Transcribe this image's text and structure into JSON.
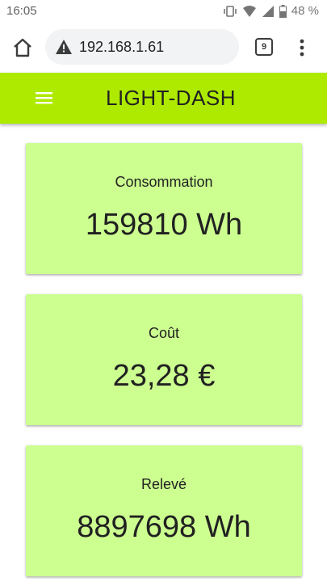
{
  "status_bar": {
    "time": "16:05",
    "battery": "48 %"
  },
  "browser": {
    "url": "192.168.1.61",
    "tab_count": "9"
  },
  "app": {
    "title": "LIGHT-DASH",
    "accent_color": "#aeea00",
    "card_color": "#ccff90"
  },
  "cards": [
    {
      "label": "Consommation",
      "value": "159810 Wh"
    },
    {
      "label": "Coût",
      "value": "23,28 €"
    },
    {
      "label": "Relevé",
      "value": "8897698 Wh"
    }
  ]
}
